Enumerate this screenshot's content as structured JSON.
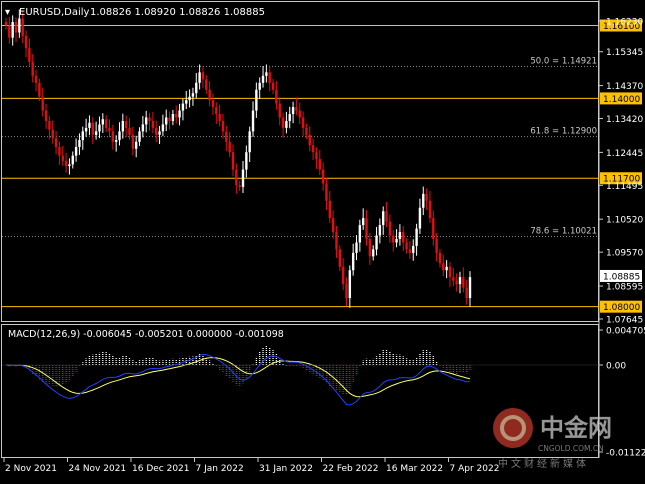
{
  "header": {
    "symbol_timeframe": "EURUSD,Daily",
    "ohlc": "1.08826 1.08920 1.08826 1.08885"
  },
  "price_axis": {
    "ticks": [
      "1.16230",
      "1.15345",
      "1.14370",
      "1.13420",
      "1.12445",
      "1.11495",
      "1.10520",
      "1.09570",
      "1.08595",
      "1.07645"
    ]
  },
  "levels": [
    {
      "label": "1.16100",
      "value": 1.161
    },
    {
      "label": "1.14000",
      "value": 1.14
    },
    {
      "label": "1.11700",
      "value": 1.117
    },
    {
      "label": "1.08000",
      "value": 1.08
    }
  ],
  "fibonacci": [
    {
      "label": "50.0 = 1.14921",
      "value": 1.14921
    },
    {
      "label": "61.8 = 1.12900",
      "value": 1.129
    },
    {
      "label": "78.6 = 1.10021",
      "value": 1.10021
    }
  ],
  "current_price": {
    "label": "1.08885",
    "value": 1.08885
  },
  "macd": {
    "title": "MACD(12,26,9) -0.006045 -0.005201 0.000000 -0.001098",
    "ticks": [
      "0.004705",
      "0.00",
      "-0.011227"
    ]
  },
  "time_axis": {
    "labels": [
      "2 Nov 2021",
      "24 Nov 2021",
      "16 Dec 2021",
      "7 Jan 2022",
      "31 Jan 2022",
      "22 Feb 2022",
      "16 Mar 2022",
      "7 Apr 2022"
    ]
  },
  "watermark": {
    "name": "中金网",
    "domain": "CNGOLD.COM.CN",
    "slogan": "中文财经新媒体"
  },
  "colors": {
    "bull": "#ffffff",
    "bear": "#e01010",
    "level_line": "#ffc000",
    "grid_dotted": "#8a8a8a",
    "macd_signal": "#ffff66",
    "macd_line": "#2040ff",
    "watermark_accent": "#c0392b"
  },
  "chart_data": {
    "type": "candlestick",
    "closes": [
      1.161,
      1.1575,
      1.162,
      1.159,
      1.163,
      1.158,
      1.1545,
      1.1505,
      1.1465,
      1.1445,
      1.1405,
      1.1365,
      1.1335,
      1.131,
      1.1285,
      1.126,
      1.1235,
      1.122,
      1.1205,
      1.121,
      1.1235,
      1.126,
      1.128,
      1.1305,
      1.1315,
      1.133,
      1.1295,
      1.1305,
      1.1325,
      1.134,
      1.1315,
      1.1305,
      1.1275,
      1.128,
      1.1305,
      1.1335,
      1.1315,
      1.1295,
      1.1255,
      1.1275,
      1.1305,
      1.1325,
      1.1345,
      1.1335,
      1.1315,
      1.1295,
      1.1305,
      1.1325,
      1.1345,
      1.1335,
      1.1355,
      1.1345,
      1.1365,
      1.1385,
      1.1395,
      1.1405,
      1.1415,
      1.1445,
      1.1475,
      1.1455,
      1.1425,
      1.1395,
      1.1375,
      1.1355,
      1.1335,
      1.1305,
      1.1275,
      1.1245,
      1.1195,
      1.115,
      1.1145,
      1.1195,
      1.1245,
      1.1305,
      1.1365,
      1.1425,
      1.1445,
      1.1465,
      1.1475,
      1.1445,
      1.1425,
      1.1385,
      1.1345,
      1.1315,
      1.1335,
      1.1355,
      1.1375,
      1.1365,
      1.1345,
      1.1315,
      1.1295,
      1.1265,
      1.1245,
      1.1225,
      1.1195,
      1.1155,
      1.1105,
      1.1055,
      1.1015,
      1.0965,
      1.0915,
      1.0865,
      1.0825,
      1.0905,
      1.0955,
      1.0985,
      1.1035,
      1.1055,
      1.0995,
      1.0945,
      1.0965,
      1.1005,
      1.1035,
      1.1075,
      1.1045,
      1.1005,
      1.0985,
      1.0995,
      1.1015,
      1.0985,
      1.0965,
      1.0955,
      1.0975,
      1.1025,
      1.1085,
      1.1125,
      1.1105,
      1.1055,
      1.0995,
      1.0955,
      1.0925,
      1.0905,
      1.0915,
      1.0885,
      1.0875,
      1.0865,
      1.0885,
      1.0855,
      1.0825,
      1.0885
    ]
  }
}
